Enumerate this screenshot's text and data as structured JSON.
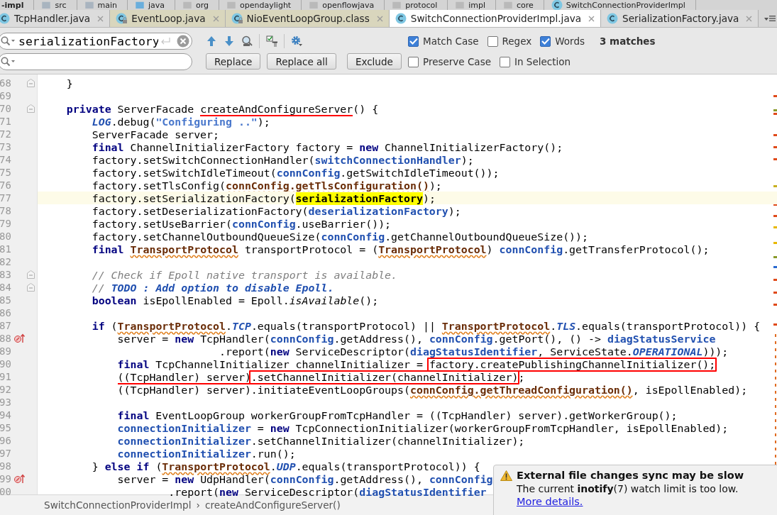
{
  "path_bar": {
    "items": [
      {
        "label": "-impl",
        "kind": "module"
      },
      {
        "label": "src",
        "kind": "folder"
      },
      {
        "label": "main",
        "kind": "folder"
      },
      {
        "label": "java",
        "kind": "source"
      },
      {
        "label": "org",
        "kind": "package"
      },
      {
        "label": "opendaylight",
        "kind": "package"
      },
      {
        "label": "openflowjava",
        "kind": "package"
      },
      {
        "label": "protocol",
        "kind": "package"
      },
      {
        "label": "impl",
        "kind": "package"
      },
      {
        "label": "core",
        "kind": "package"
      },
      {
        "label": "SwitchConnectionProviderImpl",
        "kind": "class"
      }
    ]
  },
  "tabs": [
    {
      "label": "TcpHandler.java",
      "selected": false,
      "locked": false
    },
    {
      "label": "EventLoop.java",
      "selected": false,
      "locked": true
    },
    {
      "label": "NioEventLoopGroup.class",
      "selected": false,
      "locked": true
    },
    {
      "label": "SwitchConnectionProviderImpl.java",
      "selected": true,
      "locked": false
    },
    {
      "label": "SerializationFactory.java",
      "selected": false,
      "locked": false
    }
  ],
  "find": {
    "query": "serializationFactory",
    "buttons": [
      "Replace",
      "Replace all",
      "Exclude"
    ],
    "option_rows": [
      [
        {
          "label": "Match Case",
          "checked": true
        },
        {
          "label": "Regex",
          "checked": false
        },
        {
          "label": "Words",
          "checked": true
        }
      ],
      [
        {
          "label": "Preserve Case",
          "checked": false
        },
        {
          "label": "In Selection",
          "checked": false
        }
      ]
    ],
    "matches": "3 matches"
  },
  "code": {
    "lines": [
      {
        "number": "68",
        "current": false,
        "kind": "fold",
        "segments": [
          {
            "kind": "plain",
            "text": "    }"
          }
        ]
      },
      {
        "number": "69",
        "current": false,
        "kind": "plain"
      },
      {
        "number": "70",
        "current": false,
        "kind": "fold",
        "segments": [
          {
            "kind": "keyword",
            "text": "    private"
          },
          {
            "kind": "plain",
            "text": " ServerFacade "
          },
          {
            "kind": "underlined",
            "text": "createAndConfigureServer"
          },
          {
            "kind": "plain",
            "text": "() {"
          }
        ]
      },
      {
        "number": "71",
        "current": false,
        "kind": "plain",
        "segments": [
          {
            "kind": "static",
            "text": "        LOG"
          },
          {
            "kind": "plain",
            "text": ".debug("
          },
          {
            "kind": "string",
            "text": "\"Configuring ..\""
          },
          {
            "kind": "plain",
            "text": ");"
          }
        ]
      },
      {
        "number": "72",
        "current": false,
        "kind": "plain",
        "segments": [
          {
            "kind": "plain",
            "text": "        ServerFacade server;"
          }
        ]
      },
      {
        "number": "73",
        "current": false,
        "kind": "plain",
        "segments": [
          {
            "kind": "keyword",
            "text": "        final"
          },
          {
            "kind": "plain",
            "text": " ChannelInitializerFactory factory = "
          },
          {
            "kind": "keyword",
            "text": "new"
          },
          {
            "kind": "plain",
            "text": " ChannelInitializerFactory();"
          }
        ]
      },
      {
        "number": "74",
        "current": false,
        "kind": "plain",
        "segments": [
          {
            "kind": "plain",
            "text": "        factory.setSwitchConnectionHandler("
          },
          {
            "kind": "field",
            "text": "switchConnectionHandler"
          },
          {
            "kind": "plain",
            "text": ");"
          }
        ]
      },
      {
        "number": "75",
        "current": false,
        "kind": "plain",
        "segments": [
          {
            "kind": "plain",
            "text": "        factory.setSwitchIdleTimeout("
          },
          {
            "kind": "field",
            "text": "connConfig"
          },
          {
            "kind": "plain",
            "text": ".getSwitchIdleTimeout());"
          }
        ]
      },
      {
        "number": "76",
        "current": false,
        "kind": "plain",
        "segments": [
          {
            "kind": "plain",
            "text": "        factory.setTlsConfig("
          },
          {
            "kind": "error",
            "text": "connConfig.getTlsConfiguration()"
          },
          {
            "kind": "plain",
            "text": ");"
          }
        ]
      },
      {
        "number": "77",
        "current": true,
        "kind": "plain",
        "segments": [
          {
            "kind": "plain",
            "text": "        factory.setSerializationFactory("
          },
          {
            "kind": "match",
            "text": "serializationFactory"
          },
          {
            "kind": "plain",
            "text": ");"
          }
        ]
      },
      {
        "number": "78",
        "current": false,
        "kind": "plain",
        "segments": [
          {
            "kind": "plain",
            "text": "        factory.setDeserializationFactory("
          },
          {
            "kind": "field",
            "text": "deserializationFactory"
          },
          {
            "kind": "plain",
            "text": ");"
          }
        ]
      },
      {
        "number": "79",
        "current": false,
        "kind": "plain",
        "segments": [
          {
            "kind": "plain",
            "text": "        factory.setUseBarrier("
          },
          {
            "kind": "field",
            "text": "connConfig"
          },
          {
            "kind": "plain",
            "text": ".useBarrier());"
          }
        ]
      },
      {
        "number": "80",
        "current": false,
        "kind": "plain",
        "segments": [
          {
            "kind": "plain",
            "text": "        factory.setChannelOutboundQueueSize("
          },
          {
            "kind": "field",
            "text": "connConfig"
          },
          {
            "kind": "plain",
            "text": ".getChannelOutboundQueueSize());"
          }
        ]
      },
      {
        "number": "81",
        "current": false,
        "kind": "plain",
        "segments": [
          {
            "kind": "keyword",
            "text": "        final "
          },
          {
            "kind": "error",
            "text": "TransportProtocol"
          },
          {
            "kind": "plain",
            "text": " transportProtocol = ("
          },
          {
            "kind": "error",
            "text": "TransportProtocol"
          },
          {
            "kind": "plain",
            "text": ") "
          },
          {
            "kind": "field",
            "text": "connConfig"
          },
          {
            "kind": "plain",
            "text": ".getTransferProtocol();"
          }
        ]
      },
      {
        "number": "82",
        "current": false,
        "kind": "plain"
      },
      {
        "number": "83",
        "current": false,
        "kind": "fold",
        "segments": [
          {
            "kind": "comment",
            "text": "        // Check if Epoll native transport is available."
          }
        ]
      },
      {
        "number": "84",
        "current": false,
        "kind": "fold",
        "segments": [
          {
            "kind": "comment",
            "text": "        // "
          },
          {
            "kind": "todo",
            "text": "TODO : Add option to disable Epoll."
          }
        ]
      },
      {
        "number": "85",
        "current": false,
        "kind": "plain",
        "segments": [
          {
            "kind": "keyword",
            "text": "        boolean"
          },
          {
            "kind": "plain",
            "text": " isEpollEnabled = Epoll."
          },
          {
            "kind": "italic",
            "text": "isAvailable"
          },
          {
            "kind": "plain",
            "text": "();"
          }
        ]
      },
      {
        "number": "86",
        "current": false,
        "kind": "plain"
      },
      {
        "number": "87",
        "current": false,
        "kind": "plain",
        "segments": [
          {
            "kind": "keyword",
            "text": "        if"
          },
          {
            "kind": "plain",
            "text": " ("
          },
          {
            "kind": "error",
            "text": "TransportProtocol"
          },
          {
            "kind": "plain",
            "text": "."
          },
          {
            "kind": "static",
            "text": "TCP"
          },
          {
            "kind": "plain",
            "text": ".equals(transportProtocol) || "
          },
          {
            "kind": "error",
            "text": "TransportProtocol"
          },
          {
            "kind": "plain",
            "text": "."
          },
          {
            "kind": "static",
            "text": "TLS"
          },
          {
            "kind": "plain",
            "text": ".equals(transportProtocol)) {"
          }
        ]
      },
      {
        "number": "88",
        "current": false,
        "kind": "override",
        "segments": [
          {
            "kind": "plain",
            "text": "            server = "
          },
          {
            "kind": "keyword",
            "text": "new"
          },
          {
            "kind": "plain",
            "text": " TcpHandler("
          },
          {
            "kind": "field",
            "text": "connConfig"
          },
          {
            "kind": "plain",
            "text": ".getAddress(), "
          },
          {
            "kind": "field",
            "text": "connConfig"
          },
          {
            "kind": "plain",
            "text": ".getPort(), () -> "
          },
          {
            "kind": "field",
            "text": "diagStatusService"
          }
        ]
      },
      {
        "number": "89",
        "current": false,
        "kind": "plain",
        "segments": [
          {
            "kind": "plain",
            "text": "                            .report("
          },
          {
            "kind": "keyword",
            "text": "new"
          },
          {
            "kind": "plain",
            "text": " ServiceDescriptor("
          },
          {
            "kind": "field",
            "text": "diagStatusIdentifier"
          },
          {
            "kind": "plain",
            "text": ", ServiceState."
          },
          {
            "kind": "static",
            "text": "OPERATIONAL"
          },
          {
            "kind": "plain",
            "text": ")));"
          }
        ]
      },
      {
        "number": "90",
        "current": false,
        "kind": "plain",
        "segments": [
          {
            "kind": "keyword",
            "text": "            final"
          },
          {
            "kind": "plain",
            "text": " TcpChannelInitializer channelInitializer = "
          },
          {
            "kind": "boxed",
            "text": "factory.createPublishingChannelInitializer();"
          }
        ]
      },
      {
        "number": "91",
        "current": false,
        "kind": "plain",
        "segments": [
          {
            "kind": "underlined",
            "text": "            ((TcpHandler) server)"
          },
          {
            "kind": "boxed",
            "text": ".setChannelInitializer(channelInitializer)"
          },
          {
            "kind": "plain",
            "text": ";"
          }
        ]
      },
      {
        "number": "92",
        "current": false,
        "kind": "plain",
        "segments": [
          {
            "kind": "plain",
            "text": "            ((TcpHandler) server).initiateEventLoopGroups("
          },
          {
            "kind": "error",
            "text": "connConfig.getThreadConfiguration()"
          },
          {
            "kind": "plain",
            "text": ", isEpollEnabled);"
          }
        ]
      },
      {
        "number": "93",
        "current": false,
        "kind": "plain"
      },
      {
        "number": "94",
        "current": false,
        "kind": "plain",
        "segments": [
          {
            "kind": "keyword",
            "text": "            final"
          },
          {
            "kind": "plain",
            "text": " EventLoopGroup workerGroupFromTcpHandler = ((TcpHandler) server).getWorkerGroup();"
          }
        ]
      },
      {
        "number": "95",
        "current": false,
        "kind": "plain",
        "segments": [
          {
            "kind": "field",
            "text": "            connectionInitializer"
          },
          {
            "kind": "plain",
            "text": " = "
          },
          {
            "kind": "keyword",
            "text": "new"
          },
          {
            "kind": "plain",
            "text": " TcpConnectionInitializer(workerGroupFromTcpHandler, isEpollEnabled);"
          }
        ]
      },
      {
        "number": "96",
        "current": false,
        "kind": "plain",
        "segments": [
          {
            "kind": "field",
            "text": "            connectionInitializer"
          },
          {
            "kind": "plain",
            "text": ".setChannelInitializer(channelInitializer);"
          }
        ]
      },
      {
        "number": "97",
        "current": false,
        "kind": "plain",
        "segments": [
          {
            "kind": "field",
            "text": "            connectionInitializer"
          },
          {
            "kind": "plain",
            "text": ".run();"
          }
        ]
      },
      {
        "number": "98",
        "current": false,
        "kind": "plain",
        "segments": [
          {
            "kind": "plain",
            "text": "        } "
          },
          {
            "kind": "keyword",
            "text": "else if"
          },
          {
            "kind": "plain",
            "text": " ("
          },
          {
            "kind": "error",
            "text": "TransportProtocol"
          },
          {
            "kind": "plain",
            "text": "."
          },
          {
            "kind": "static",
            "text": "UDP"
          },
          {
            "kind": "plain",
            "text": ".equals(transportProtocol)) {"
          }
        ]
      },
      {
        "number": "99",
        "current": false,
        "kind": "override",
        "segments": [
          {
            "kind": "plain",
            "text": "            server = "
          },
          {
            "kind": "keyword",
            "text": "new"
          },
          {
            "kind": "plain",
            "text": " UdpHandler("
          },
          {
            "kind": "field",
            "text": "connConfig"
          },
          {
            "kind": "plain",
            "text": ".getAddress(), "
          },
          {
            "kind": "field",
            "text": "connConfig"
          }
        ]
      },
      {
        "number": "00",
        "current": false,
        "kind": "plain",
        "segments": [
          {
            "kind": "plain",
            "text": "                    .report("
          },
          {
            "kind": "keyword",
            "text": "new"
          },
          {
            "kind": "plain",
            "text": " ServiceDescriptor("
          },
          {
            "kind": "field",
            "text": "diagStatusIdentifier"
          }
        ]
      }
    ]
  },
  "breadcrumb": {
    "items": [
      "SwitchConnectionProviderImpl",
      "createAndConfigureServer()"
    ],
    "separator": "›"
  },
  "notification": {
    "title": "External file changes sync may be slow",
    "body": "The current **inotify**(7) watch limit is too low.",
    "link": "More details."
  }
}
